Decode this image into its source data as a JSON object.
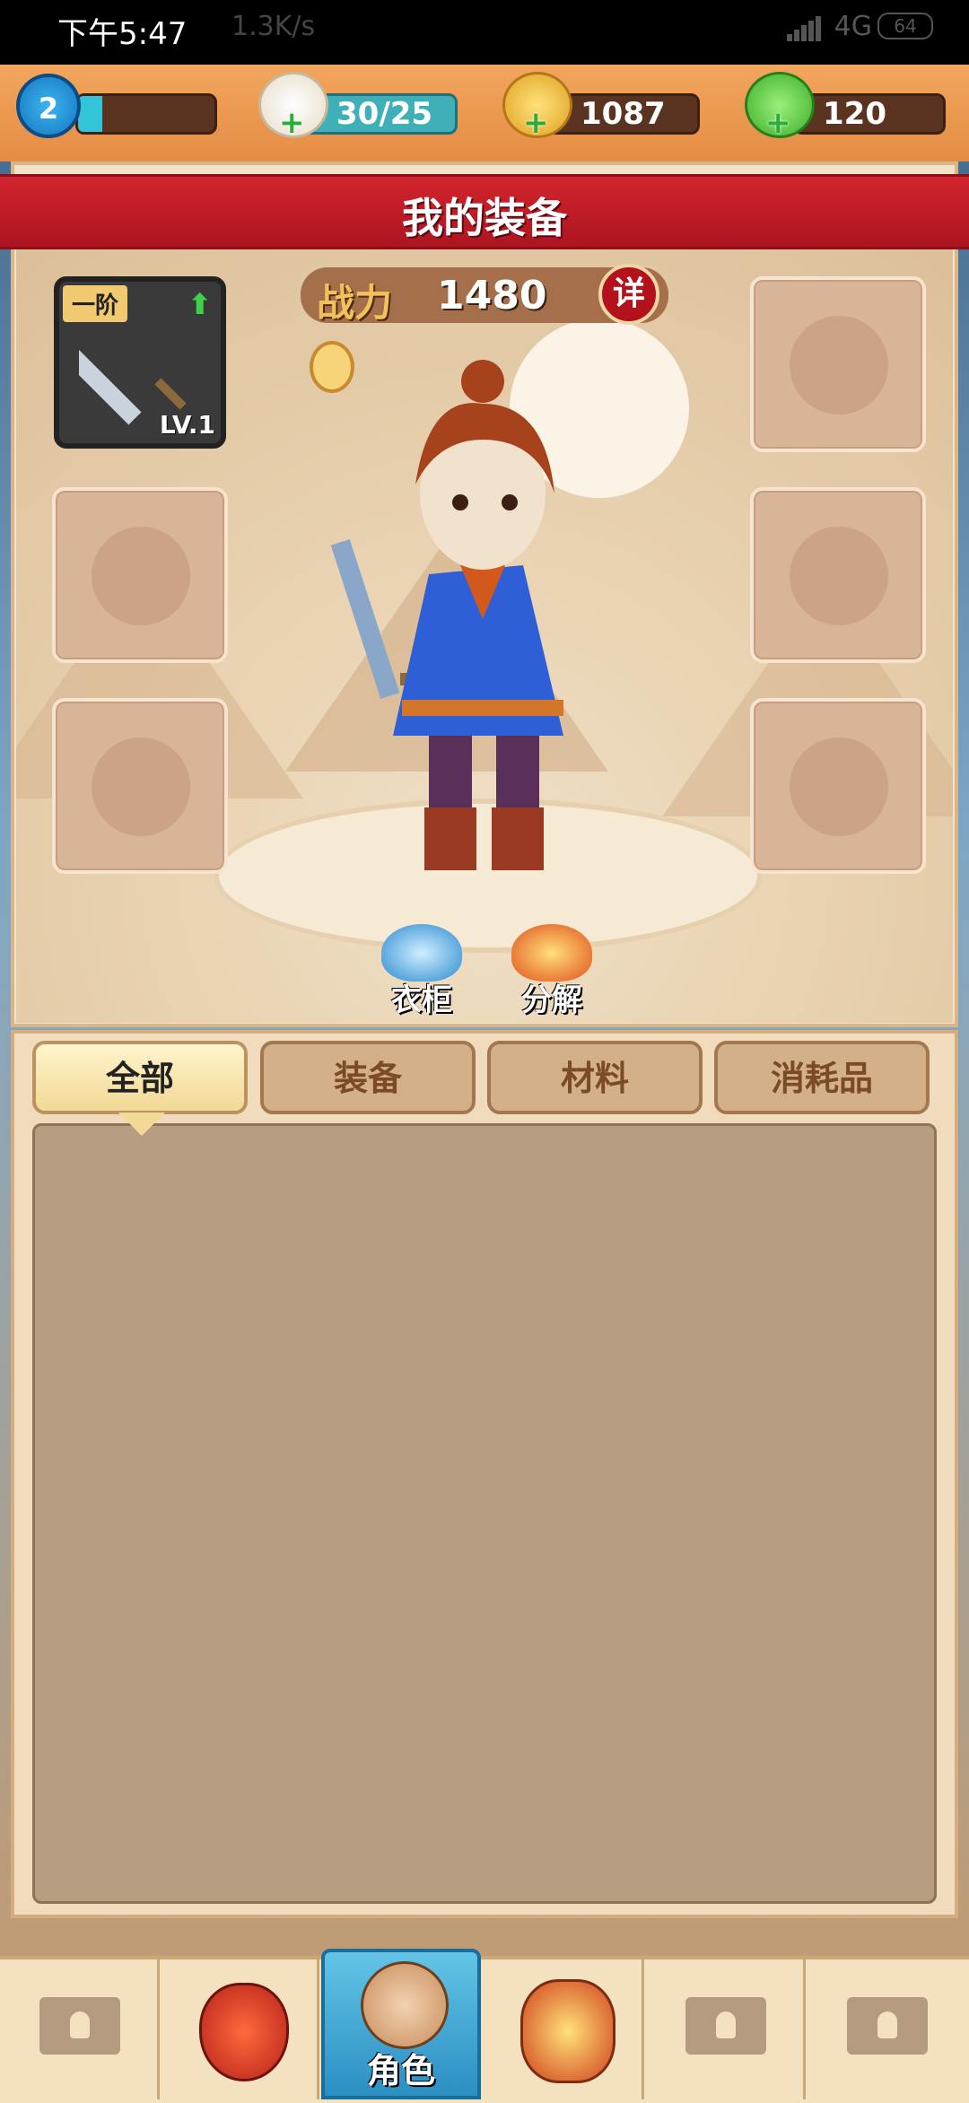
{
  "status_bar": {
    "time": "下午5:47",
    "speed": "1.3K/s",
    "network": "4G",
    "battery": "64"
  },
  "resources": {
    "level": "2",
    "xp_fraction": 0.18,
    "stamina": "30/25",
    "gold": "1087",
    "jade": "120"
  },
  "header": {
    "title": "我的装备"
  },
  "character": {
    "power_label": "战力",
    "power_value": "1480",
    "detail_label": "详",
    "weapon": {
      "tier": "一阶",
      "level": "LV.1"
    },
    "actions": [
      {
        "label": "衣柜"
      },
      {
        "label": "分解"
      }
    ]
  },
  "inventory": {
    "tabs": [
      {
        "label": "全部",
        "active": true
      },
      {
        "label": "装备",
        "active": false
      },
      {
        "label": "材料",
        "active": false
      },
      {
        "label": "消耗品",
        "active": false
      }
    ]
  },
  "bottom_nav": {
    "active_label": "角色",
    "items": [
      "locked",
      "bag",
      "character",
      "treasure",
      "locked",
      "locked"
    ]
  }
}
